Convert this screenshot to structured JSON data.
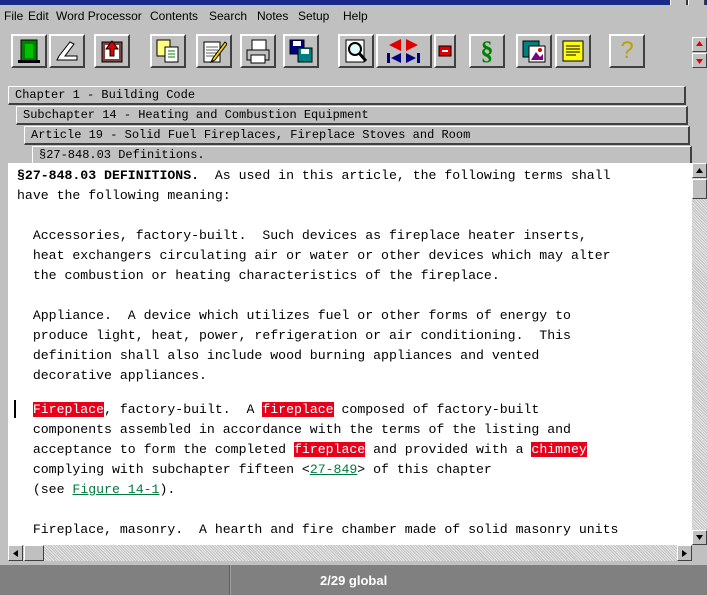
{
  "menu": [
    "File",
    "Edit",
    "Word Processor",
    "Contents",
    "Search",
    "Notes",
    "Setup",
    "Help"
  ],
  "toolbar": {
    "buttons": [
      {
        "name": "exit-door-icon"
      },
      {
        "name": "back-arrow-icon"
      },
      {
        "name": "book-upload-icon"
      },
      {
        "name": "copy-documents-icon"
      },
      {
        "name": "notepad-pencil-icon"
      },
      {
        "name": "printer-icon"
      },
      {
        "name": "save-diskette-icon"
      },
      {
        "name": "magnifier-search-icon"
      },
      {
        "name": "prev-next-hit-icon"
      },
      {
        "name": "stop-icon"
      },
      {
        "name": "section-symbol-icon"
      },
      {
        "name": "picture-icon"
      },
      {
        "name": "note-page-icon"
      },
      {
        "name": "help-question-icon"
      }
    ],
    "section_glyph": "§",
    "help_glyph": "?"
  },
  "breadcrumbs": [
    "Chapter 1 - Building Code",
    "Subchapter 14 - Heating and Combustion Equipment",
    "Article 19 - Solid Fuel Fireplaces, Fireplace Stoves and Room",
    "§27-848.03 Definitions."
  ],
  "document": {
    "heading": "§27-848.03 DEFINITIONS.",
    "heading_rest": "  As used in this article, the following terms shall",
    "line2": "have the following meaning:",
    "acc1": "  Accessories, factory-built.  Such devices as fireplace heater inserts,",
    "acc2": "  heat exchangers circulating air or water or other devices which may alter",
    "acc3": "  the combustion or heating characteristics of the fireplace.",
    "app1": "  Appliance.  A device which utilizes fuel or other forms of energy to",
    "app2": "  produce light, heat, power, refrigeration or air conditioning.  This",
    "app3": "  definition shall also include wood burning appliances and vented",
    "app4": "  decorative appliances.",
    "fp_hit1": "Fireplace",
    "fp_a": ", factory-built.  A ",
    "fp_hit2": "fireplace",
    "fp_b": " composed of factory-built",
    "fp2": "  components assembled in accordance with the terms of the listing and",
    "fp3_a": "  acceptance to form the completed ",
    "fp_hit3": "fireplace",
    "fp3_b": " and provided with a ",
    "fp_hit4": "chimney",
    "fp4_a": "  complying with subchapter fifteen <",
    "link_section": "27-849",
    "fp4_b": "> of this chapter",
    "fp5_a": "  (see ",
    "link_figure": "Figure 14-1",
    "fp5_b": ").",
    "mas1": "  Fireplace, masonry.  A hearth and fire chamber made of solid masonry units"
  },
  "status": "2/29 global",
  "colors": {
    "highlight": "#e8001a",
    "link": "#007a3d",
    "chrome": "#c0c0c0"
  }
}
